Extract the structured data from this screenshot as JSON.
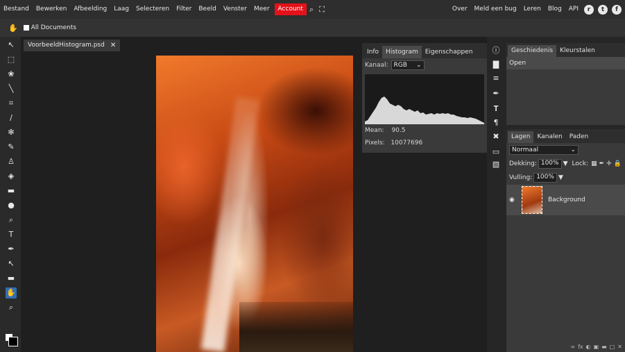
{
  "menu": {
    "items": [
      "Bestand",
      "Bewerken",
      "Afbeelding",
      "Laag",
      "Selecteren",
      "Filter",
      "Beeld",
      "Venster",
      "Meer"
    ],
    "account": "Account",
    "right_items": [
      "Over",
      "Meld een bug",
      "Leren",
      "Blog",
      "API"
    ]
  },
  "options": {
    "all_documents_label": "All Documents",
    "all_documents_checked": true
  },
  "document": {
    "tab_title": "VoorbeeldHistogram.psd",
    "close": "✕"
  },
  "histogram_panel": {
    "tabs": [
      "Info",
      "Histogram",
      "Eigenschappen"
    ],
    "active_tab": "Histogram",
    "channel_label": "Kanaal:",
    "channel_value": "RGB",
    "mean_label": "Mean:",
    "mean_value": "90.5",
    "pixels_label": "Pixels:",
    "pixels_value": "10077696"
  },
  "history_panel": {
    "tabs": [
      "Geschiedenis",
      "Kleurstalen"
    ],
    "active_tab": "Geschiedenis",
    "items": [
      "Open"
    ]
  },
  "layers_panel": {
    "tabs": [
      "Lagen",
      "Kanalen",
      "Paden"
    ],
    "active_tab": "Lagen",
    "blend_mode": "Normaal",
    "opacity_label": "Dekking:",
    "opacity_value": "100%",
    "lock_label": "Lock:",
    "fill_label": "Vulling:",
    "fill_value": "100%",
    "layers": [
      {
        "name": "Background",
        "visible": true
      }
    ]
  },
  "colors": {
    "account_red": "#e3121a",
    "active_tool_blue": "#2f6fb5",
    "panel_bg": "#3a3a3a"
  }
}
